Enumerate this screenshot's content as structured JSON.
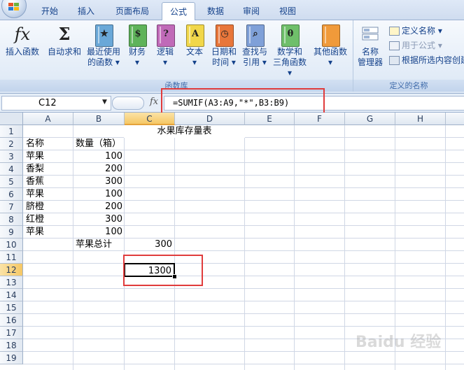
{
  "ribbon_tabs": [
    "开始",
    "插入",
    "页面布局",
    "公式",
    "数据",
    "审阅",
    "视图"
  ],
  "active_tab": "公式",
  "ribbon": {
    "function_library": {
      "label": "函数库",
      "buttons": [
        {
          "line1": "插入函数",
          "line2": "",
          "icon": "fx-icon"
        },
        {
          "line1": "自动求和",
          "line2": "",
          "icon": "sigma-icon"
        },
        {
          "line1": "最近使用",
          "line2": "的函数 ▾",
          "icon": "recent-star-book-icon"
        },
        {
          "line1": "财务",
          "line2": "▾",
          "icon": "finance-book-icon"
        },
        {
          "line1": "逻辑",
          "line2": "▾",
          "icon": "logic-question-book-icon"
        },
        {
          "line1": "文本",
          "line2": "▾",
          "icon": "text-book-icon"
        },
        {
          "line1": "日期和",
          "line2": "时间 ▾",
          "icon": "datetime-book-icon"
        },
        {
          "line1": "查找与",
          "line2": "引用 ▾",
          "icon": "lookup-book-icon"
        },
        {
          "line1": "数学和",
          "line2": "三角函数 ▾",
          "icon": "math-theta-book-icon"
        },
        {
          "line1": "其他函数",
          "line2": "▾",
          "icon": "more-functions-book-icon"
        }
      ]
    },
    "defined_names": {
      "label": "定义的名称",
      "manager_line1": "名称",
      "manager_line2": "管理器",
      "items": [
        "定义名称 ▾",
        "用于公式 ▾",
        "根据所选内容创建"
      ]
    }
  },
  "formula_bar": {
    "name_box": "C12",
    "fx": "fx",
    "formula": "=SUMIF(A3:A9,\"*\",B3:B9)"
  },
  "sheet": {
    "columns": [
      "A",
      "B",
      "C",
      "D",
      "E",
      "F",
      "G",
      "H"
    ],
    "rows": [
      "1",
      "2",
      "3",
      "4",
      "5",
      "6",
      "7",
      "8",
      "9",
      "10",
      "11",
      "12",
      "13",
      "14",
      "15",
      "16",
      "17",
      "18",
      "19"
    ],
    "title": "水果库存量表",
    "header_name": "名称",
    "header_qty": "数量（箱）",
    "items": [
      {
        "name": "苹果",
        "qty": "100"
      },
      {
        "name": "香梨",
        "qty": "200"
      },
      {
        "name": "香蕉",
        "qty": "300"
      },
      {
        "name": "苹果",
        "qty": "100"
      },
      {
        "name": "脐橙",
        "qty": "200"
      },
      {
        "name": "红橙",
        "qty": "300"
      },
      {
        "name": "苹果",
        "qty": "100"
      }
    ],
    "apple_total_label": "苹果总计",
    "apple_total": "300",
    "c12_value": "1300",
    "selected_cell": "C12"
  },
  "watermark": "Baidu 经验",
  "colors": {
    "highlight_border": "#e03c3c",
    "ribbon_text": "#15428b"
  }
}
